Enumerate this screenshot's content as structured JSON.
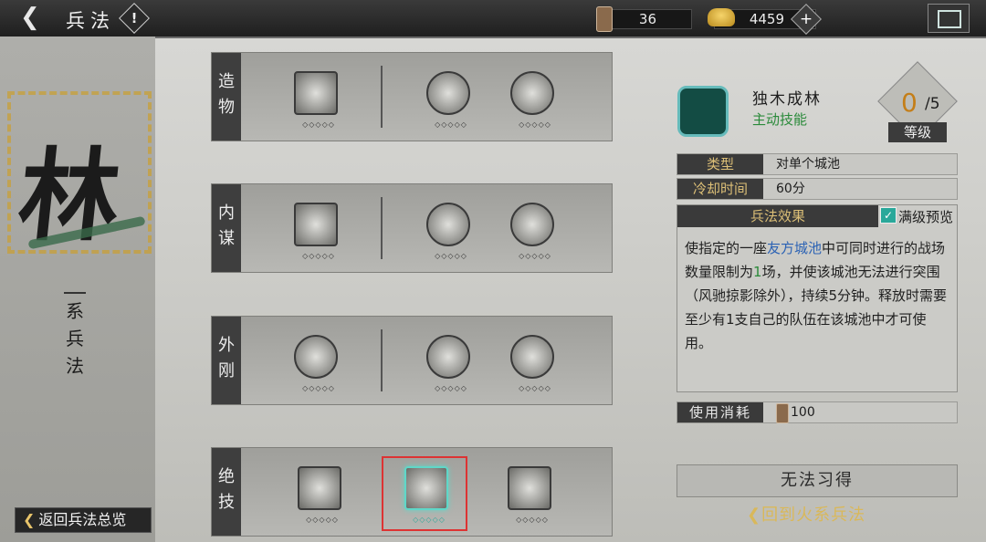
{
  "header": {
    "title": "兵法",
    "info_label": "!",
    "tokens": "36",
    "gold": "4459",
    "add_label": "+"
  },
  "left": {
    "big_char": "林",
    "subtitle_chars": [
      "系",
      "兵",
      "法"
    ],
    "return_label": "返回兵法总览"
  },
  "rows": [
    {
      "label": [
        "造",
        "物"
      ],
      "skills": [
        "flag-skill-icon",
        "scarecrow-skill-icon",
        "banner-skill-icon"
      ]
    },
    {
      "label": [
        "内",
        "谋"
      ],
      "skills": [
        "warrior-skill-icon",
        "hammer-skill-icon",
        "scroll-skill-icon"
      ]
    },
    {
      "label": [
        "外",
        "刚"
      ],
      "skills": [
        "tablet-skill-icon",
        "catapult-skill-icon",
        "troops-skill-icon"
      ]
    },
    {
      "label": [
        "绝",
        "技"
      ],
      "skills": [
        "siege-cart-skill-icon",
        "forest-skill-icon",
        "assassin-skill-icon"
      ]
    }
  ],
  "skill_level_dots": "◇◇◇◇◇",
  "detail": {
    "name": "独木成林",
    "type_label": "主动技能",
    "level_current": "0",
    "level_max": "/5",
    "level_tag": "等级",
    "kind_key": "类型",
    "kind_value": "对单个城池",
    "cooldown_key": "冷却时间",
    "cooldown_value": "60分",
    "effect_header": "兵法效果",
    "preview_check": "✓",
    "preview_label": "满级预览",
    "effect_text_1": "使指定的一座",
    "effect_highlight": "友方城池",
    "effect_text_2": "中可同时进行的战场数量限制为",
    "effect_num": "1",
    "effect_text_3": "场，并使该城池无法进行突围（风驰掠影除外），持续5分钟。释放时需要至少有1支自己的队伍在该城池中才可使用。",
    "cost_key": "使用消耗",
    "cost_value": "100",
    "learn_button": "无法习得",
    "back_link": "回到火系兵法"
  },
  "colors": {
    "gold_accent": "#dcbf77",
    "green_text": "#2a8a3a",
    "link_blue": "#2b62b4",
    "level_orange": "#c47e18",
    "selection_red": "#dd3333"
  }
}
